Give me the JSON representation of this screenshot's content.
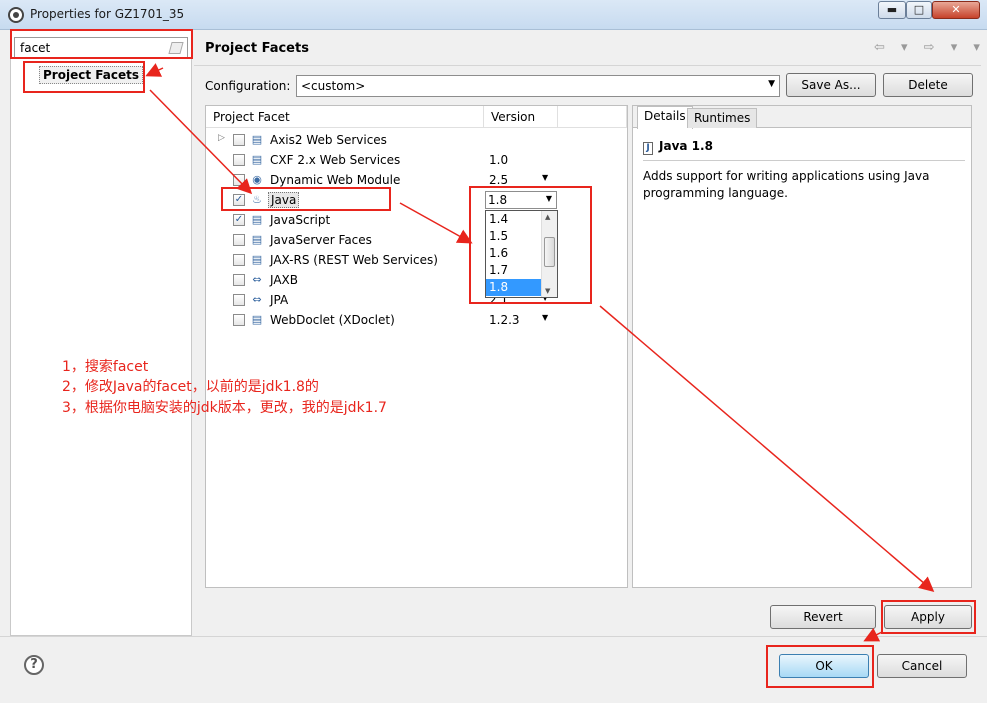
{
  "window": {
    "title": "Properties for GZ1701_35",
    "min": "▬",
    "max": "□",
    "close": "✕"
  },
  "left": {
    "filter_value": "facet",
    "tree_item": "Project Facets"
  },
  "header": {
    "title": "Project Facets",
    "nav": "⇦ ▾ ⇨ ▾ ▾"
  },
  "config": {
    "label": "Configuration:",
    "value": "<custom>",
    "save_as": "Save As...",
    "delete": "Delete"
  },
  "table": {
    "col_facet": "Project Facet",
    "col_version": "Version",
    "rows": [
      {
        "name": "Axis2 Web Services",
        "version": "",
        "checked": false,
        "expand": "▷",
        "icon": "page"
      },
      {
        "name": "CXF 2.x Web Services",
        "version": "1.0",
        "checked": false,
        "icon": "page"
      },
      {
        "name": "Dynamic Web Module",
        "version": "2.5",
        "checked": false,
        "icon": "web"
      },
      {
        "name": "Java",
        "version": "1.8",
        "checked": true,
        "icon": "java"
      },
      {
        "name": "JavaScript",
        "version": "",
        "checked": true,
        "icon": "page"
      },
      {
        "name": "JavaServer Faces",
        "version": "",
        "checked": false,
        "icon": "page"
      },
      {
        "name": "JAX-RS (REST Web Services)",
        "version": "",
        "checked": false,
        "icon": "page"
      },
      {
        "name": "JAXB",
        "version": "",
        "checked": false,
        "icon": "arrows"
      },
      {
        "name": "JPA",
        "version": "2.1",
        "checked": false,
        "icon": "arrows"
      },
      {
        "name": "WebDoclet (XDoclet)",
        "version": "1.2.3",
        "checked": false,
        "icon": "page"
      }
    ],
    "combo_value": "1.8",
    "options": [
      "1.4",
      "1.5",
      "1.6",
      "1.7",
      "1.8"
    ]
  },
  "details": {
    "tab_details": "Details",
    "tab_runtimes": "Runtimes",
    "title": "Java 1.8",
    "description": "Adds support for writing applications using Java programming language."
  },
  "buttons": {
    "revert": "Revert",
    "apply": "Apply",
    "ok": "OK",
    "cancel": "Cancel",
    "help": "?"
  },
  "annotations": {
    "line1": "1，搜索facet",
    "line2": "2，修改Java的facet，以前的是jdk1.8的",
    "line3": "3，根据你电脑安装的jdk版本，更改，我的是jdk1.7"
  },
  "colors": {
    "annotation_red": "#e8251d",
    "highlight_blue": "#3399ff"
  }
}
